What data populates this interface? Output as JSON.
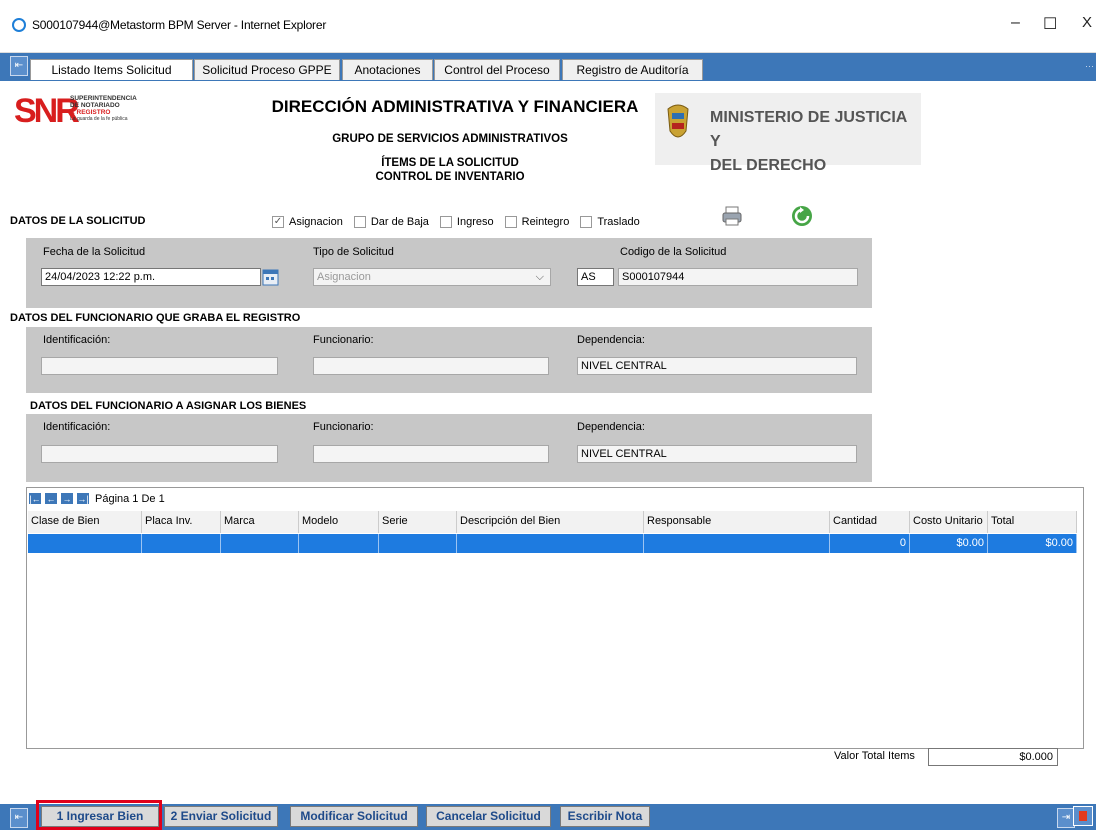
{
  "window": {
    "title": "S000107944@Metastorm BPM Server - Internet Explorer",
    "minimize": "–",
    "maximize": "☐",
    "close": "X"
  },
  "tabs": [
    {
      "label": "Listado Items Solicitud"
    },
    {
      "label": "Solicitud Proceso GPPE"
    },
    {
      "label": "Anotaciones"
    },
    {
      "label": "Control del Proceso"
    },
    {
      "label": "Registro de Auditoría"
    }
  ],
  "header": {
    "logo_letters": "SNR",
    "logo_text": [
      "SUPERINTENDENCIA",
      "DE NOTARIADO",
      "& REGISTRO",
      "La guarda de la fe pública"
    ],
    "title": "DIRECCIÓN ADMINISTRATIVA Y FINANCIERA",
    "subtitle": "GRUPO DE SERVICIOS ADMINISTRATIVOS",
    "line3": "ÍTEMS DE LA SOLICITUD",
    "line4": "CONTROL DE INVENTARIO",
    "ministerio_line1": "MINISTERIO DE JUSTICIA Y",
    "ministerio_line2": "DEL DERECHO"
  },
  "solicitud": {
    "section_title": "DATOS DE LA SOLICITUD",
    "checkboxes": [
      {
        "label": "Asignacion",
        "checked": true
      },
      {
        "label": "Dar de Baja",
        "checked": false
      },
      {
        "label": "Ingreso",
        "checked": false
      },
      {
        "label": "Reintegro",
        "checked": false
      },
      {
        "label": "Traslado",
        "checked": false
      }
    ],
    "fecha_label": "Fecha de la Solicitud",
    "fecha_value": "24/04/2023 12:22 p.m.",
    "tipo_label": "Tipo de Solicitud",
    "tipo_value": "Asignacion",
    "codigo_label": "Codigo de la Solicitud",
    "codigo_prefix": "AS",
    "codigo_value": "S000107944"
  },
  "graba": {
    "section_title": "DATOS DEL FUNCIONARIO QUE GRABA EL REGISTRO",
    "id_label": "Identificación:",
    "funcionario_label": "Funcionario:",
    "dependencia_label": "Dependencia:",
    "dependencia_value": "NIVEL CENTRAL"
  },
  "asignar": {
    "section_title": "DATOS DEL FUNCIONARIO A ASIGNAR LOS BIENES",
    "id_label": "Identificación:",
    "funcionario_label": "Funcionario:",
    "dependencia_label": "Dependencia:",
    "dependencia_value": "NIVEL CENTRAL"
  },
  "grid": {
    "pager_text": "Página 1 De 1",
    "columns": [
      "Clase de Bien",
      "Placa Inv.",
      "Marca",
      "Modelo",
      "Serie",
      "Descripción del Bien",
      "Responsable",
      "Cantidad",
      "Costo Unitario",
      "Total"
    ],
    "row": {
      "cantidad": "0",
      "costo": "$0.00",
      "total": "$0.00"
    }
  },
  "totals": {
    "label": "Valor Total Items",
    "value": "$0.000"
  },
  "bottom_buttons": [
    {
      "label": "1 Ingresar Bien"
    },
    {
      "label": "2 Enviar Solicitud"
    },
    {
      "label": "Modificar Solicitud"
    },
    {
      "label": "Cancelar Solicitud"
    },
    {
      "label": "Escribir Nota"
    }
  ],
  "colors": {
    "accent": "#3d77b8",
    "selection": "#1e7be0",
    "highlight": "#e0001a"
  }
}
